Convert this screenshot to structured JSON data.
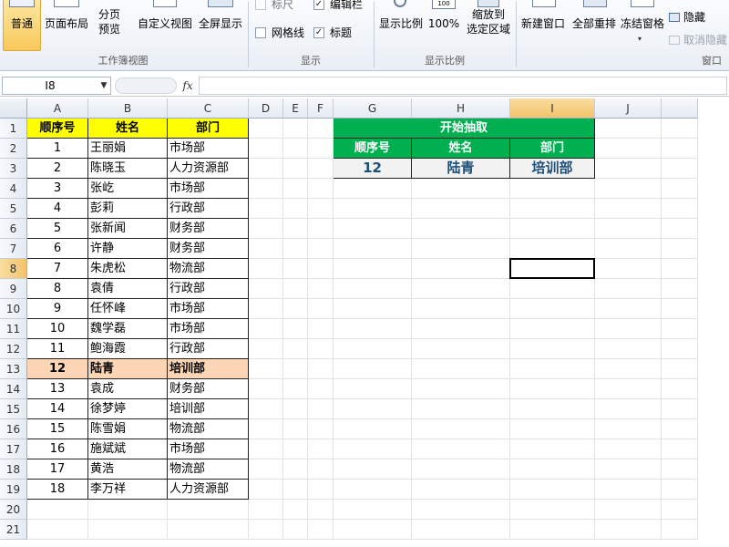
{
  "ribbon": {
    "workbook_views": {
      "label": "工作簿视图",
      "normal": "普通",
      "page_layout": "页面布局",
      "page_break_1": "分页",
      "page_break_2": "预览",
      "custom_views": "自定义视图",
      "full_screen": "全屏显示"
    },
    "show": {
      "label": "显示",
      "ruler": "标尺",
      "formula_bar": "编辑栏",
      "gridlines": "网格线",
      "headings": "标题"
    },
    "zoom": {
      "label": "显示比例",
      "zoom": "显示比例",
      "zoom100": "100%",
      "zoom_sel_1": "缩放到",
      "zoom_sel_2": "选定区域"
    },
    "window": {
      "label": "窗口",
      "new_window": "新建窗口",
      "arrange_all": "全部重排",
      "freeze_panes": "冻结窗格",
      "hide": "隐藏",
      "unhide": "取消隐藏"
    }
  },
  "formula_bar": {
    "name_box": "I8",
    "fx": "fx",
    "content": ""
  },
  "columns": [
    "A",
    "B",
    "C",
    "D",
    "E",
    "F",
    "G",
    "H",
    "I",
    "J"
  ],
  "rows": [
    "1",
    "2",
    "3",
    "4",
    "5",
    "6",
    "7",
    "8",
    "9",
    "10",
    "11",
    "12",
    "13",
    "14",
    "15",
    "16",
    "17",
    "18",
    "19",
    "20",
    "21"
  ],
  "table": {
    "headers": [
      "顺序号",
      "姓名",
      "部门"
    ],
    "rows": [
      [
        "1",
        "王丽娟",
        "市场部"
      ],
      [
        "2",
        "陈晓玉",
        "人力资源部"
      ],
      [
        "3",
        "张屹",
        "市场部"
      ],
      [
        "4",
        "彭莉",
        "行政部"
      ],
      [
        "5",
        "张新闻",
        "财务部"
      ],
      [
        "6",
        "许静",
        "财务部"
      ],
      [
        "7",
        "朱虎松",
        "物流部"
      ],
      [
        "8",
        "袁倩",
        "行政部"
      ],
      [
        "9",
        "任怀峰",
        "市场部"
      ],
      [
        "10",
        "魏学磊",
        "市场部"
      ],
      [
        "11",
        "鲍海霞",
        "行政部"
      ],
      [
        "12",
        "陆青",
        "培训部"
      ],
      [
        "13",
        "袁成",
        "财务部"
      ],
      [
        "14",
        "徐梦婷",
        "培训部"
      ],
      [
        "15",
        "陈雪娟",
        "物流部"
      ],
      [
        "16",
        "施斌斌",
        "市场部"
      ],
      [
        "17",
        "黄浩",
        "物流部"
      ],
      [
        "18",
        "李万祥",
        "人力资源部"
      ]
    ]
  },
  "draw": {
    "title": "开始抽取",
    "headers": [
      "顺序号",
      "姓名",
      "部门"
    ],
    "result": [
      "12",
      "陆青",
      "培训部"
    ]
  },
  "colors": {
    "header_yellow": "#ffff00",
    "highlight_row": "#fcd5b4",
    "draw_green": "#00b050",
    "draw_result_bg": "#f2f2f2",
    "draw_result_text": "#1f4e79",
    "ribbon_selected": "#fbd36b"
  }
}
